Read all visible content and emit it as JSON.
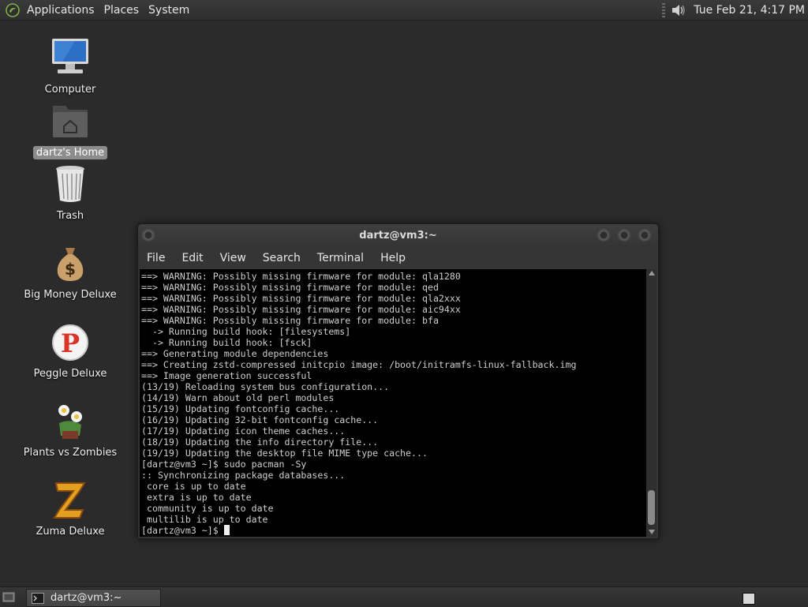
{
  "top_panel": {
    "menus": [
      "Applications",
      "Places",
      "System"
    ],
    "clock": "Tue Feb 21,  4:17 PM",
    "icons": [
      "mate-logo-icon",
      "volume-icon"
    ]
  },
  "desktop": {
    "icons": [
      {
        "label": "Computer",
        "icon": "computer-icon",
        "selected": false
      },
      {
        "label": "dartz's Home",
        "icon": "home-folder-icon",
        "selected": true
      },
      {
        "label": "Trash",
        "icon": "trash-icon",
        "selected": false
      },
      {
        "label": "Big Money Deluxe",
        "icon": "money-bag-icon",
        "selected": false
      },
      {
        "label": "Peggle Deluxe",
        "icon": "peggle-icon",
        "selected": false
      },
      {
        "label": "Plants vs Zombies",
        "icon": "plants-vs-zombies-icon",
        "selected": false
      },
      {
        "label": "Zuma Deluxe",
        "icon": "zuma-icon",
        "selected": false
      }
    ]
  },
  "terminal": {
    "title": "dartz@vm3:~",
    "menus": [
      "File",
      "Edit",
      "View",
      "Search",
      "Terminal",
      "Help"
    ],
    "lines": [
      "==> WARNING: Possibly missing firmware for module: qla1280",
      "==> WARNING: Possibly missing firmware for module: qed",
      "==> WARNING: Possibly missing firmware for module: qla2xxx",
      "==> WARNING: Possibly missing firmware for module: aic94xx",
      "==> WARNING: Possibly missing firmware for module: bfa",
      "  -> Running build hook: [filesystems]",
      "  -> Running build hook: [fsck]",
      "==> Generating module dependencies",
      "==> Creating zstd-compressed initcpio image: /boot/initramfs-linux-fallback.img",
      "==> Image generation successful",
      "(13/19) Reloading system bus configuration...",
      "(14/19) Warn about old perl modules",
      "(15/19) Updating fontconfig cache...",
      "(16/19) Updating 32-bit fontconfig cache...",
      "(17/19) Updating icon theme caches...",
      "(18/19) Updating the info directory file...",
      "(19/19) Updating the desktop file MIME type cache...",
      "[dartz@vm3 ~]$ sudo pacman -Sy",
      ":: Synchronizing package databases...",
      " core is up to date",
      " extra is up to date",
      " community is up to date",
      " multilib is up to date"
    ],
    "prompt": "[dartz@vm3 ~]$ "
  },
  "taskbar": {
    "task_label": "dartz@vm3:~",
    "icons": [
      "show-desktop-icon",
      "terminal-icon",
      "workspace-switcher"
    ]
  },
  "colors": {
    "desktop_bg": "#2b2b2b",
    "panel_bg": "#333333",
    "terminal_bg": "#000000",
    "terminal_fg": "#cfcfcf"
  }
}
